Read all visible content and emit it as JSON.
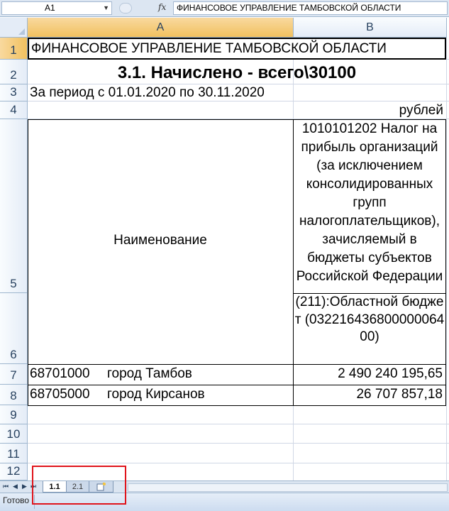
{
  "formula_bar": {
    "cell_ref": "A1",
    "fx_label": "fx",
    "content": "ФИНАНСОВОЕ УПРАВЛЕНИЕ ТАМБОВСКОЙ ОБЛАСТИ"
  },
  "columns": [
    "A",
    "B"
  ],
  "rows": [
    "1",
    "2",
    "3",
    "4",
    "5",
    "6",
    "7",
    "8",
    "9",
    "10",
    "11",
    "12"
  ],
  "sheet": {
    "a1": "ФИНАНСОВОЕ УПРАВЛЕНИЕ ТАМБОВСКОЙ ОБЛАСТИ",
    "title": "3.1. Начислено - всего\\30100",
    "period": "За период с 01.01.2020 по 30.11.2020",
    "units": "рублей",
    "header_name": "Наименование",
    "header_tax": "1010101202 Налог на прибыль организаций (за исключением консолидированных групп налогоплательщиков), зачисляемый в бюджеты субъектов Российской Федерации",
    "header_budget": "(211):Областной бюджет (03221643680000006400)",
    "data_rows": [
      {
        "code": "68701000",
        "name": "город Тамбов",
        "value": "2 490 240 195,65"
      },
      {
        "code": "68705000",
        "name": "город Кирсанов",
        "value": "26 707 857,18"
      }
    ]
  },
  "tabs": {
    "active": "1.1",
    "other": "2.1",
    "new_sheet_icon": "insert-sheet-icon"
  },
  "status": {
    "text": "Готово"
  }
}
